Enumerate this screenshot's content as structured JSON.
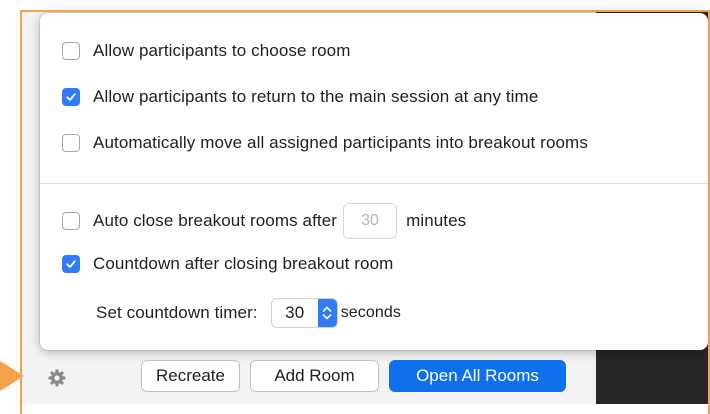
{
  "options": {
    "choose_room": {
      "label": "Allow participants to choose room",
      "checked": false
    },
    "return_main": {
      "label": "Allow participants to return to the main session at any time",
      "checked": true
    },
    "auto_move": {
      "label": "Automatically move all assigned participants into breakout rooms",
      "checked": false
    },
    "auto_close": {
      "label": "Auto close breakout rooms after",
      "checked": false,
      "value": "30",
      "unit": "minutes"
    },
    "countdown": {
      "label": "Countdown after closing breakout room",
      "checked": true
    }
  },
  "timer": {
    "label": "Set countdown timer:",
    "value": "30",
    "unit": "seconds"
  },
  "buttons": {
    "recreate": "Recreate",
    "add_room": "Add Room",
    "open_all": "Open All Rooms"
  },
  "icons": {
    "settings": "gear-icon",
    "stepper": "chevron-up-down-icon",
    "check": "checkmark-icon"
  },
  "colors": {
    "accent": "#2f7cf6",
    "primary_button": "#0e71eb",
    "highlight_frame": "#f2a24b",
    "background": "#f3f3f3"
  }
}
